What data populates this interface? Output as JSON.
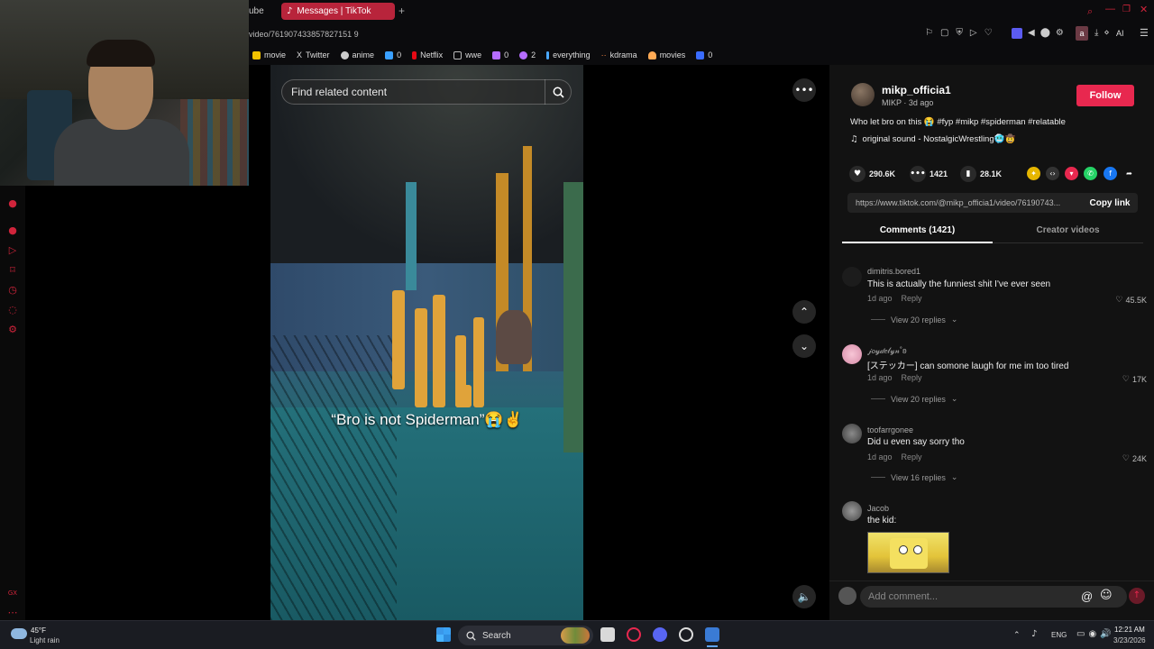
{
  "browser": {
    "partial_tab": "ube",
    "active_tab": "Messages | TikTok",
    "new_tab": "+",
    "url": "video/761907433857827151 9"
  },
  "bookmarks": [
    {
      "label": "movie",
      "color": "#f2c200"
    },
    {
      "label": "Twitter",
      "color": "#ffffff"
    },
    {
      "label": "anime",
      "color": "#cccccc"
    },
    {
      "label": "0",
      "color": "#3aa0ff"
    },
    {
      "label": "Netflix",
      "color": "#e50914"
    },
    {
      "label": "wwe",
      "color": "#bbbbbb"
    },
    {
      "label": "0",
      "color": "#b56cff"
    },
    {
      "label": "2",
      "color": "#b56cff"
    },
    {
      "label": "everything",
      "color": "#4aa8ff"
    },
    {
      "label": "kdrama",
      "color": "#ff8844"
    },
    {
      "label": "movies",
      "color": "#ffaa55"
    },
    {
      "label": "0",
      "color": "#3a6cff"
    }
  ],
  "video": {
    "search_placeholder": "Find related content",
    "caption": "“Bro is not Spiderman”😭✌️"
  },
  "post": {
    "username": "mikp_officia1",
    "display": "MIKP · 3d ago",
    "follow": "Follow",
    "description": "Who let bro on this 😭 #fyp #mikp #spiderman #relatable",
    "sound": "original sound - NostalgicWrestling🥶🤠",
    "likes": "290.6K",
    "comments": "1421",
    "saves": "28.1K",
    "link": "https://www.tiktok.com/@mikp_officia1/video/76190743...",
    "copy_link": "Copy link"
  },
  "tabs": {
    "comments": "Comments (1421)",
    "creator": "Creator videos"
  },
  "comment_list": [
    {
      "user": "dimitris.bored1",
      "text": "This is actually the funniest shit I've ever seen",
      "time": "1d ago",
      "reply": "Reply",
      "likes": "45.5K",
      "replies": "View 20 replies"
    },
    {
      "user": "𝒿𝑜𝓎𝒹𝑒𝓁𝓎𝓃˚ʚ",
      "text": "[ステッカー] can somone laugh for me im too tired",
      "time": "1d ago",
      "reply": "Reply",
      "likes": "17K",
      "replies": "View 20 replies"
    },
    {
      "user": "toofarrgonee",
      "text": "Did u even say sorry tho",
      "time": "1d ago",
      "reply": "Reply",
      "likes": "24K",
      "replies": "View 16 replies"
    },
    {
      "user": "Jacob",
      "text": "the kid:"
    }
  ],
  "comment_input_placeholder": "Add comment...",
  "taskbar": {
    "temp": "45°F",
    "weather": "Light rain",
    "search": "Search",
    "lang": "ENG",
    "time": "12:21 AM",
    "date": "3/23/2026"
  },
  "colors": {
    "accent": "#e8284f",
    "tab_active": "#b8243b"
  }
}
